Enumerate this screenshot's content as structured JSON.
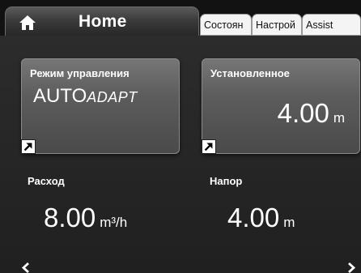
{
  "tabs": {
    "home": "Home",
    "status": "Состоян",
    "settings": "Настрой",
    "assist": "Assist"
  },
  "cards": {
    "control_mode": {
      "title": "Режим управления",
      "value_main": "AUTO",
      "value_suffix": "ADAPT"
    },
    "setpoint": {
      "title": "Установленное",
      "value": "4.00",
      "unit": "m"
    }
  },
  "readouts": {
    "flow": {
      "label": "Расход",
      "value": "8.00",
      "unit": "m³/h"
    },
    "head": {
      "label": "Напор",
      "value": "4.00",
      "unit": "m"
    }
  },
  "icons": {
    "home": "home-icon",
    "shortcut": "arrow-up-right-icon",
    "prev": "chevron-left-icon",
    "next": "chevron-right-icon"
  }
}
